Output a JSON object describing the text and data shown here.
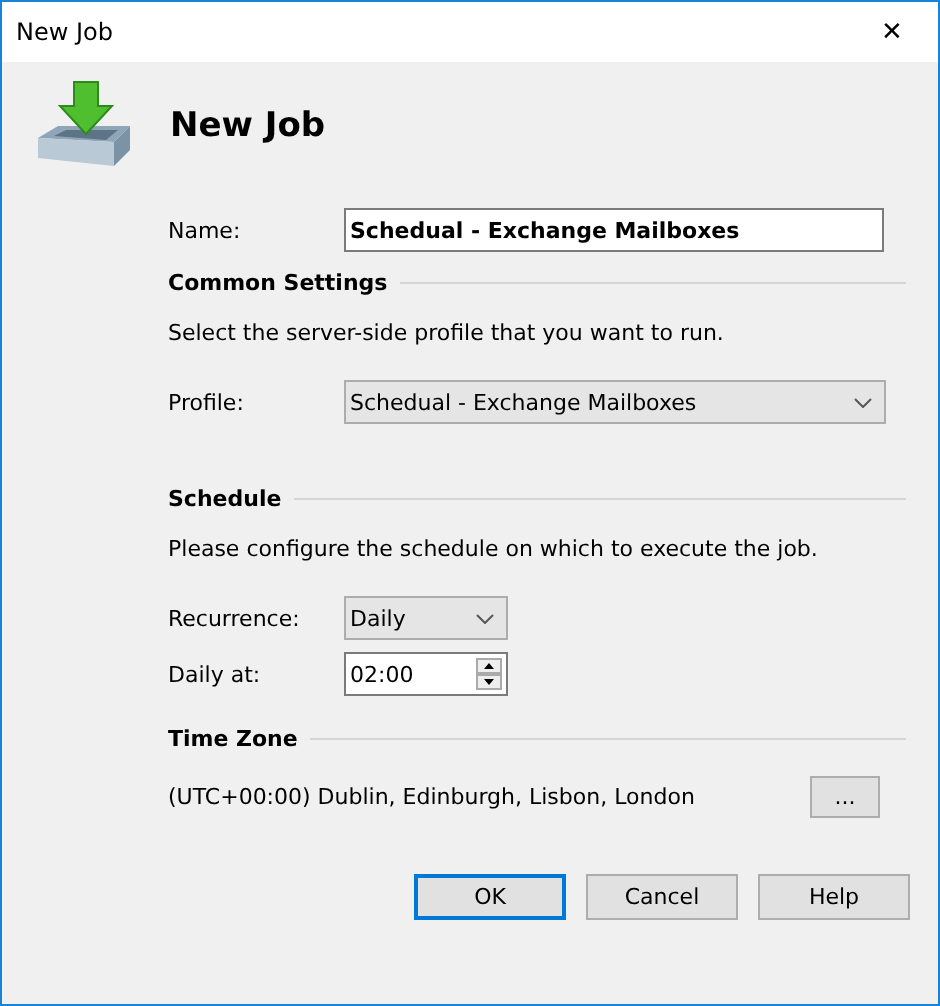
{
  "window": {
    "title": "New Job",
    "close": "✕"
  },
  "heading": "New Job",
  "name_field": {
    "label": "Name:",
    "value": "Schedual - Exchange Mailboxes"
  },
  "sections": [
    {
      "title": "Common Settings",
      "description": "Select the server-side profile that you want to run.",
      "rows": [
        {
          "kind": "dropdown",
          "label": "Profile:",
          "value": "Schedual - Exchange Mailboxes",
          "wide": true
        }
      ]
    },
    {
      "title": "Schedule",
      "description": "Please configure the schedule on which to execute the job.",
      "rows": [
        {
          "kind": "dropdown",
          "label": "Recurrence:",
          "value": "Daily",
          "wide": false
        },
        {
          "kind": "spinner",
          "label": "Daily at:",
          "value": "02:00"
        }
      ]
    },
    {
      "title": "Time Zone",
      "timezone": {
        "text": "(UTC+00:00) Dublin, Edinburgh, Lisbon, London",
        "button": "..."
      }
    }
  ],
  "buttons": [
    {
      "label": "OK",
      "default": true
    },
    {
      "label": "Cancel",
      "default": false
    },
    {
      "label": "Help",
      "default": false
    }
  ]
}
